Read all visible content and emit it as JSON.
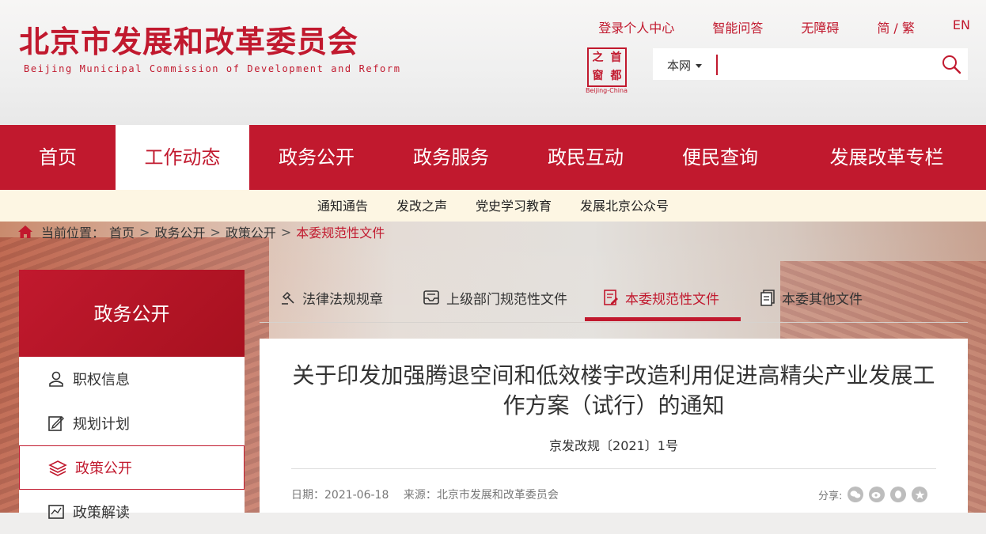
{
  "header": {
    "title_cn": "北京市发展和改革委员会",
    "title_en": "Beijing Municipal Commission of Development and Reform",
    "top_links": [
      "登录个人中心",
      "智能问答",
      "无障碍",
      "简 / 繁",
      "EN"
    ],
    "seal_chars": [
      "之",
      "首",
      "窗",
      "都"
    ],
    "seal_caption": "Beijing-China"
  },
  "search": {
    "scope": "本网",
    "placeholder": ""
  },
  "nav": {
    "items": [
      "首页",
      "工作动态",
      "政务公开",
      "政务服务",
      "政民互动",
      "便民查询",
      "发展改革专栏"
    ],
    "active_index": 1
  },
  "subnav": {
    "items": [
      "通知通告",
      "发改之声",
      "党史学习教育",
      "发展北京公众号"
    ]
  },
  "breadcrumb": {
    "label": "当前位置：",
    "items": [
      "首页",
      "政务公开",
      "政策公开"
    ],
    "current": "本委规范性文件",
    "separator": ">"
  },
  "sidebar": {
    "title": "政务公开",
    "items": [
      "职权信息",
      "规划计划",
      "政策公开",
      "政策解读"
    ],
    "active_index": 2
  },
  "tabs": {
    "items": [
      "法律法规规章",
      "上级部门规范性文件",
      "本委规范性文件",
      "本委其他文件"
    ],
    "active_index": 2
  },
  "article": {
    "title": "关于印发加强腾退空间和低效楼宇改造利用促进高精尖产业发展工作方案（试行）的通知",
    "doc_no": "京发改规〔2021〕1号",
    "date_label": "日期：2021-06-18",
    "source_label": "来源：北京市发展和改革委员会",
    "share_label": "分享:"
  },
  "colors": {
    "brand_red": "#c1192e",
    "subnav_bg": "#fdf6e3"
  }
}
